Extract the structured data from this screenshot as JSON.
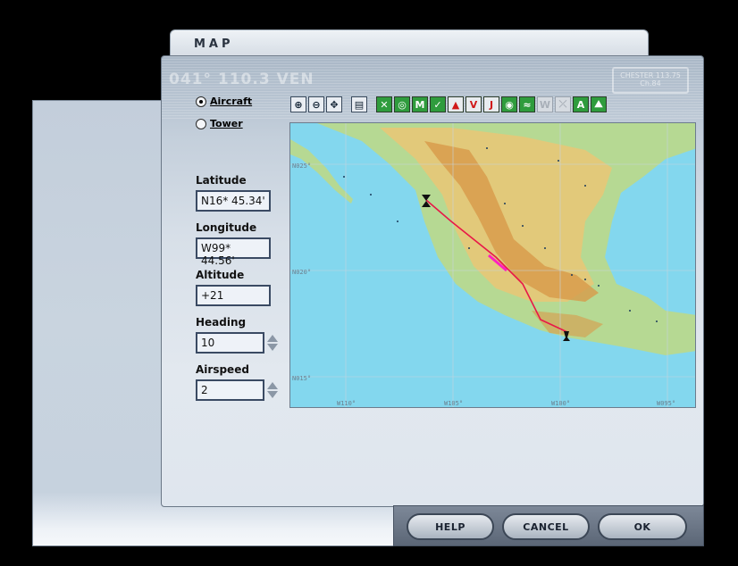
{
  "window": {
    "title": "MAP",
    "deco_frequency": "041° 110.3 VEN",
    "deco_box": "CHESTER 113.75 Ch.84"
  },
  "view_mode": {
    "options": [
      {
        "label": "Aircraft",
        "selected": true
      },
      {
        "label": "Tower",
        "selected": false
      }
    ]
  },
  "fields": {
    "latitude": {
      "label": "Latitude",
      "value": "N16* 45.34'"
    },
    "longitude": {
      "label": "Longitude",
      "value": "W99* 44.56'"
    },
    "altitude": {
      "label": "Altitude",
      "value": "+21"
    },
    "heading": {
      "label": "Heading",
      "value": "10"
    },
    "airspeed": {
      "label": "Airspeed",
      "value": "2"
    }
  },
  "toolbar": {
    "tools": [
      {
        "name": "zoom-in-icon",
        "glyph": "⊕",
        "style": "gray"
      },
      {
        "name": "zoom-out-icon",
        "glyph": "⊖",
        "style": "gray"
      },
      {
        "name": "center-icon",
        "glyph": "✥",
        "style": "gray"
      },
      {
        "name": "print-icon",
        "glyph": "▤",
        "style": "gray"
      },
      {
        "name": "airports-icon",
        "glyph": "✕",
        "style": "green"
      },
      {
        "name": "vor-icon",
        "glyph": "◎",
        "style": "green"
      },
      {
        "name": "ndb-icon",
        "glyph": "M",
        "style": "green"
      },
      {
        "name": "check-icon",
        "glyph": "✓",
        "style": "green"
      },
      {
        "name": "intersection-icon",
        "glyph": "▲",
        "style": "red"
      },
      {
        "name": "victor-airways-icon",
        "glyph": "V",
        "style": "red"
      },
      {
        "name": "jet-airways-icon",
        "glyph": "J",
        "style": "red"
      },
      {
        "name": "approach-icon",
        "glyph": "◉",
        "style": "green"
      },
      {
        "name": "route-icon",
        "glyph": "≈",
        "style": "green"
      },
      {
        "name": "weather-icon",
        "glyph": "W",
        "style": "dim"
      },
      {
        "name": "wind-icon",
        "glyph": "⤫",
        "style": "dim"
      },
      {
        "name": "label-icon",
        "glyph": "A",
        "style": "green"
      },
      {
        "name": "terrain-icon",
        "glyph": "⛰",
        "style": "green"
      }
    ]
  },
  "map": {
    "lat_labels": [
      "N025°",
      "N020°",
      "N015°"
    ],
    "lon_labels": [
      "W110°",
      "W105°",
      "W100°",
      "W095°"
    ],
    "colors": {
      "ocean": "#83d7ee",
      "land_low": "#b6d993",
      "land_mid": "#e2c97a",
      "land_high": "#d89a4a",
      "route": "#e81848"
    }
  },
  "buttons": {
    "help": "HELP",
    "cancel": "CANCEL",
    "ok": "OK"
  }
}
